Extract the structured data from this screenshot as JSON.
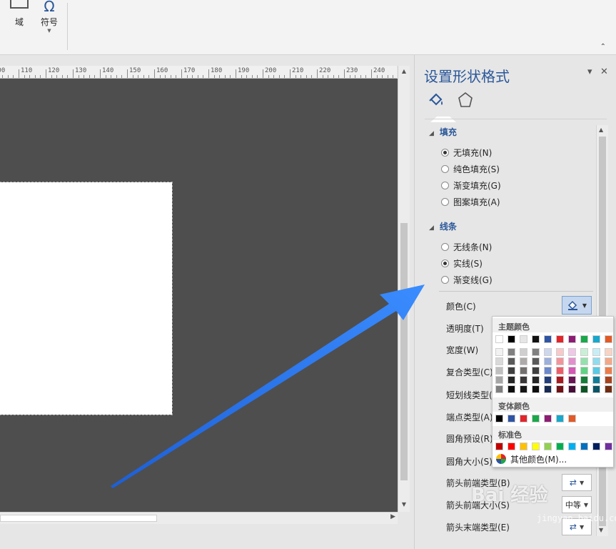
{
  "ribbon": {
    "field_label": "域",
    "symbol_label": "符号",
    "symbol_glyph": "Ω"
  },
  "ruler": {
    "labels": [
      "100",
      "110",
      "120",
      "130",
      "140",
      "150",
      "160",
      "170",
      "180",
      "190",
      "200",
      "210",
      "220",
      "230",
      "240"
    ]
  },
  "panel": {
    "title": "设置形状格式",
    "dropdown_glyph": "▾",
    "close_glyph": "✕",
    "fill_section": {
      "title": "填充",
      "options": [
        {
          "label": "无填充(N)",
          "selected": true
        },
        {
          "label": "纯色填充(S)",
          "selected": false
        },
        {
          "label": "渐变填充(G)",
          "selected": false
        },
        {
          "label": "图案填充(A)",
          "selected": false
        }
      ]
    },
    "line_section": {
      "title": "线条",
      "options": [
        {
          "label": "无线条(N)",
          "selected": false
        },
        {
          "label": "实线(S)",
          "selected": true
        },
        {
          "label": "渐变线(G)",
          "selected": false
        }
      ]
    },
    "properties": {
      "color": "颜色(C)",
      "transparency": "透明度(T)",
      "width": "宽度(W)",
      "compound_type": "复合类型(C)",
      "dash_type": "短划线类型(D)",
      "cap_type": "端点类型(A)",
      "corner_preset": "圆角预设(R)",
      "corner_size": "圆角大小(S)",
      "arrow_begin_type": "箭头前端类型(B)",
      "arrow_begin_size": "箭头前端大小(S)",
      "arrow_end_type": "箭头末端类型(E)"
    },
    "arrow_begin_size_value": "中等"
  },
  "color_popup": {
    "theme_header": "主题颜色",
    "variant_header": "变体颜色",
    "standard_header": "标准色",
    "more_colors": "其他颜色(M)...",
    "theme_top": [
      "#ffffff",
      "#000000",
      "#e7e6e6",
      "#111111",
      "#2f54a3",
      "#e0252b",
      "#8c1d73",
      "#1aa84b",
      "#17a8cc",
      "#e15a27"
    ],
    "theme_shades": [
      [
        "#f2f2f2",
        "#808080",
        "#d0cece",
        "#808080",
        "#cdd7ee",
        "#f9c9ca",
        "#f0c7e6",
        "#c9f0d6",
        "#c7eef7",
        "#f8d3c3"
      ],
      [
        "#d9d9d9",
        "#595959",
        "#aeaaaa",
        "#595959",
        "#9cb0dd",
        "#f3949a",
        "#e38fcd",
        "#94e1ad",
        "#8fdcee",
        "#f2a887"
      ],
      [
        "#bfbfbf",
        "#3f3f3f",
        "#757070",
        "#3f3f3f",
        "#6c89cc",
        "#ec5e67",
        "#d458b4",
        "#5fd384",
        "#58cae6",
        "#eb7d4b"
      ],
      [
        "#a6a6a6",
        "#262626",
        "#3a3838",
        "#262626",
        "#233f7b",
        "#a81a1f",
        "#691556",
        "#137e38",
        "#117e99",
        "#a9431d"
      ],
      [
        "#7f7f7f",
        "#0d0d0d",
        "#171616",
        "#0d0d0d",
        "#172a52",
        "#701115",
        "#460e39",
        "#0d5425",
        "#0b5466",
        "#712d13"
      ]
    ],
    "variant_colors": [
      "#000000",
      "#2f54a3",
      "#e0252b",
      "#1aa84b",
      "#8c1d73",
      "#17a8cc",
      "#e15a27"
    ],
    "standard_colors": [
      "#c00000",
      "#ff0000",
      "#ffc000",
      "#ffff00",
      "#92d050",
      "#00b050",
      "#00b0f0",
      "#0070c0",
      "#002060",
      "#7030a0"
    ]
  },
  "watermark": {
    "brand": "Bai 经验",
    "url": "jingyan.baidu.com"
  },
  "colors": {
    "canvas": "#4e4e4e",
    "accent": "#2b579a",
    "arrow": "#2a7cf0"
  }
}
